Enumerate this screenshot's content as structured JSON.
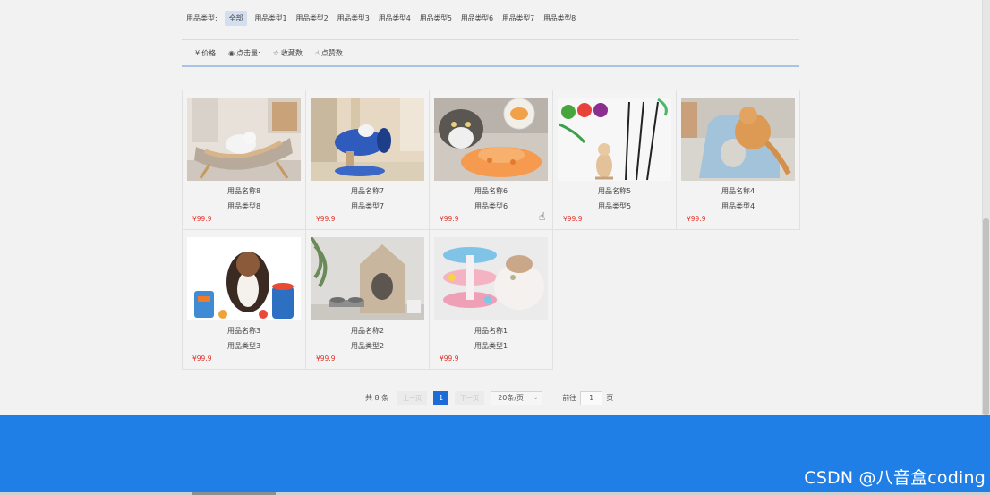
{
  "filter": {
    "label": "用品类型:",
    "options": [
      "全部",
      "用品类型1",
      "用品类型2",
      "用品类型3",
      "用品类型4",
      "用品类型5",
      "用品类型6",
      "用品类型7",
      "用品类型8"
    ],
    "selected": "全部"
  },
  "sort": [
    {
      "icon": "yen-icon",
      "glyph": "¥",
      "label": "价格"
    },
    {
      "icon": "eye-icon",
      "glyph": "◉",
      "label": "点击量:"
    },
    {
      "icon": "star-icon",
      "glyph": "☆",
      "label": "收藏数"
    },
    {
      "icon": "thumbs-up-icon",
      "glyph": "👍",
      "label": "点赞数"
    }
  ],
  "products": [
    {
      "name": "用品名称8",
      "type": "用品类型8",
      "price": "¥99.9",
      "image": "cat-on-lounge-chair"
    },
    {
      "name": "用品名称7",
      "type": "用品类型7",
      "price": "¥99.9",
      "image": "cat-scratching-tunnel"
    },
    {
      "name": "用品名称6",
      "type": "用品类型6",
      "price": "¥99.9",
      "image": "cat-with-orange-toy"
    },
    {
      "name": "用品名称5",
      "type": "用品类型5",
      "price": "¥99.9",
      "image": "cat-teaser-wands"
    },
    {
      "name": "用品名称4",
      "type": "用品类型4",
      "price": "¥99.9",
      "image": "cat-on-scratcher"
    },
    {
      "name": "用品名称3",
      "type": "用品类型3",
      "price": "¥99.9",
      "image": "dog-with-bowls"
    },
    {
      "name": "用品名称2",
      "type": "用品类型2",
      "price": "¥99.9",
      "image": "pet-house-with-bowls"
    },
    {
      "name": "用品名称1",
      "type": "用品类型1",
      "price": "¥99.9",
      "image": "cat-track-toy"
    }
  ],
  "pagination": {
    "total": "共 8 条",
    "prev": "上一页",
    "current": "1",
    "next": "下一页",
    "page_size": "20条/页",
    "goto_label": "前往",
    "goto_value": "1",
    "page_unit": "页"
  },
  "watermark": "CSDN @八音盒coding",
  "colors": {
    "accent": "#1b6cd6",
    "footer": "#1f7fe6",
    "price": "#e3362b"
  }
}
